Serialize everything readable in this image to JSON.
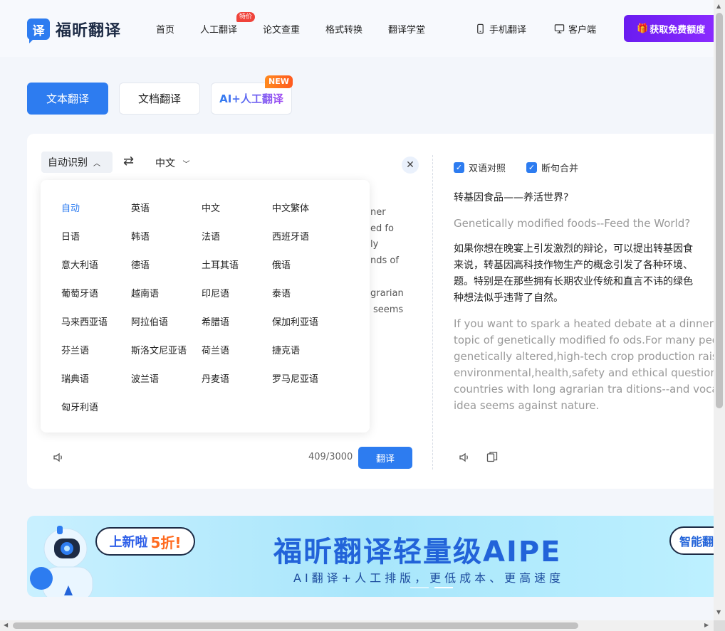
{
  "header": {
    "logo_text": "福昕翻译",
    "logo_mark": "译",
    "nav": [
      "首页",
      "人工翻译",
      "论文查重",
      "格式转换",
      "翻译学堂"
    ],
    "nav_badge": "特价",
    "mobile": "手机翻译",
    "client": "客户端",
    "cta": "获取免费额度",
    "cta_icon": "gift-icon"
  },
  "tabs": {
    "text": "文本翻译",
    "doc": "文档翻译",
    "ai": "AI+人工翻译",
    "ai_badge": "NEW"
  },
  "translator": {
    "source_lang": "自动识别",
    "target_lang": "中文",
    "source_fragments": [
      "ner",
      "ed fo",
      "ly",
      "nds of",
      "grarian",
      "seems"
    ],
    "count": "409/3000",
    "translate_button": "翻译",
    "languages": [
      "自动",
      "英语",
      "中文",
      "中文繁体",
      "日语",
      "韩语",
      "法语",
      "西班牙语",
      "意大利语",
      "德语",
      "土耳其语",
      "俄语",
      "葡萄牙语",
      "越南语",
      "印尼语",
      "泰语",
      "马来西亚语",
      "阿拉伯语",
      "希腊语",
      "保加利亚语",
      "芬兰语",
      "斯洛文尼亚语",
      "荷兰语",
      "捷克语",
      "瑞典语",
      "波兰语",
      "丹麦语",
      "罗马尼亚语",
      "匈牙利语"
    ],
    "active_language": "自动"
  },
  "output": {
    "bilingual": "双语对照",
    "merge": "断句合并",
    "lines": [
      {
        "lang": "cn",
        "text": "转基因食品——养活世界?"
      },
      {
        "lang": "en",
        "text": "Genetically modified foods--Feed the World?"
      },
      {
        "lang": "cn",
        "text": "如果你想在晚宴上引发激烈的辩论，可以提出转基因食"
      },
      {
        "lang": "cn",
        "text": "来说，转基因高科技作物生产的概念引发了各种环境、"
      },
      {
        "lang": "cn",
        "text": "题。特别是在那些拥有长期农业传统和直言不讳的绿色"
      },
      {
        "lang": "cn",
        "text": "种想法似乎违背了自然。"
      },
      {
        "lang": "en",
        "text": "If you want to spark a heated debate at a dinner p"
      },
      {
        "lang": "en",
        "text": "topic of genetically modified fo ods.For many peop"
      },
      {
        "lang": "en",
        "text": "genetically altered,high-tech crop production raise"
      },
      {
        "lang": "en",
        "text": "environmental,health,safety and ethical questions."
      },
      {
        "lang": "en",
        "text": "countries with long agrarian tra ditions--and vocal"
      },
      {
        "lang": "en",
        "text": "idea seems against nature."
      }
    ]
  },
  "banner": {
    "bubble": "上新啦",
    "bubble_pct": "5折!",
    "title": "福昕翻译轻量级AIPE",
    "subtitle": "AI翻译+人工排版，更低成本、更高速度",
    "tag": "智能翻"
  }
}
